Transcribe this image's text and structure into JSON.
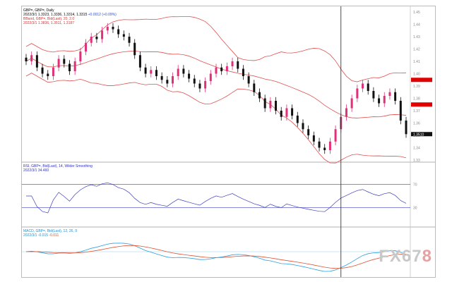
{
  "main_header": {
    "line1": "GBP=, GBP=, Daily",
    "line2": "2022/3/1  1.3323, 1.3336, 1.3314, 1.3315",
    "line2_change": "+0.0012 (+0.09%)",
    "line3": "BBand, GBP=, Bid(Last), 20, 2.0",
    "line4": "2022/3/1  1.3836, 1.3511, 1.3187"
  },
  "rsi_header": {
    "line1": "RSI, GBP=, Bid(Last), 14, Wilder Smoothing",
    "line2": "2022/3/1  34.460"
  },
  "macd_header": {
    "line1": "MACD, GBP=, Bid(Last), 12, 26, 9",
    "line2": "2022/3/1  -0.015",
    "line2_signal": "-0.011"
  },
  "watermark": {
    "text": "FX67",
    "accent": "8"
  },
  "colors": {
    "bullish": "#e0307a",
    "bearish": "#111111",
    "bbands": "#e05050",
    "rsi": "#4040c0",
    "macd": "#2aa0e0",
    "signal": "#e05030",
    "price_label": "#e00000"
  },
  "chart_data": {
    "type": "line",
    "title": "GBP= Daily with Bollinger Bands, RSI(14), MACD(12,26,9)",
    "ylim": [
      1.33,
      1.45
    ],
    "price_ticks": [
      "1.45",
      "1.44",
      "1.43",
      "1.42",
      "1.41",
      "1.40",
      "1.39",
      "1.38",
      "1.37",
      "1.36",
      "1.35",
      "1.34",
      "1.33"
    ],
    "current_price": "1.3510",
    "highlight_prices": [
      "1.3950",
      "1.3750"
    ],
    "closes": [
      1.41,
      1.415,
      1.405,
      1.4,
      1.398,
      1.405,
      1.412,
      1.408,
      1.402,
      1.41,
      1.418,
      1.425,
      1.43,
      1.428,
      1.435,
      1.438,
      1.436,
      1.432,
      1.43,
      1.425,
      1.415,
      1.405,
      1.4,
      1.403,
      1.398,
      1.395,
      1.392,
      1.398,
      1.404,
      1.4,
      1.396,
      1.392,
      1.388,
      1.394,
      1.4,
      1.405,
      1.402,
      1.406,
      1.41,
      1.404,
      1.398,
      1.392,
      1.385,
      1.38,
      1.372,
      1.378,
      1.37,
      1.365,
      1.372,
      1.366,
      1.36,
      1.355,
      1.35,
      1.345,
      1.34,
      1.338,
      1.345,
      1.355,
      1.365,
      1.372,
      1.38,
      1.388,
      1.392,
      1.386,
      1.38,
      1.376,
      1.382,
      1.385,
      1.378,
      1.362,
      1.351
    ],
    "rsi_levels": [
      70,
      30
    ],
    "rsi_ticks": [
      "70",
      "30"
    ],
    "cursor_index": 58
  }
}
